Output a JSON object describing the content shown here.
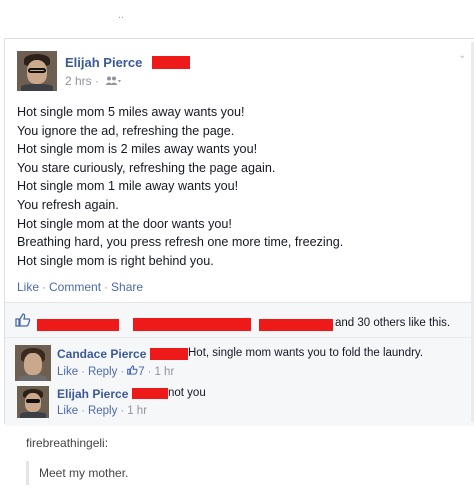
{
  "post": {
    "author": "Elijah Pierce",
    "time": "2 hrs",
    "audience_icon": "friends-icon",
    "lines": [
      "Hot single mom 5 miles away wants you!",
      "You ignore the ad, refreshing the page.",
      "Hot single mom is 2 miles away wants you!",
      "You stare curiously, refreshing the page again.",
      "Hot single mom 1 mile away wants you!",
      "You refresh again.",
      "Hot single mom at the door wants you!",
      "Breathing hard, you press refresh one more time, freezing.",
      "Hot single mom is right behind you."
    ],
    "actions": {
      "like": "Like",
      "comment": "Comment",
      "share": "Share"
    }
  },
  "likes": {
    "text": "and 30 others like this.",
    "thumb_color": "#4b6aa8",
    "redaction_color": "#ee1a1a"
  },
  "comments": [
    {
      "name": "Candace Pierce",
      "text": "Hot, single mom wants you to fold the laundry.",
      "like": "Like",
      "reply": "Reply",
      "like_count": "7",
      "time": "1 hr"
    },
    {
      "name": "Elijah Pierce",
      "text": "not you",
      "like": "Like",
      "reply": "Reply",
      "time": "1 hr"
    }
  ],
  "tumblr": {
    "username": "firebreathingeli:",
    "quote": "Meet my mother."
  },
  "colors": {
    "link_blue": "#3b5998",
    "action_blue": "#4b6aa8",
    "muted_gray": "#90949c",
    "redaction_red": "#ee1a1a"
  }
}
